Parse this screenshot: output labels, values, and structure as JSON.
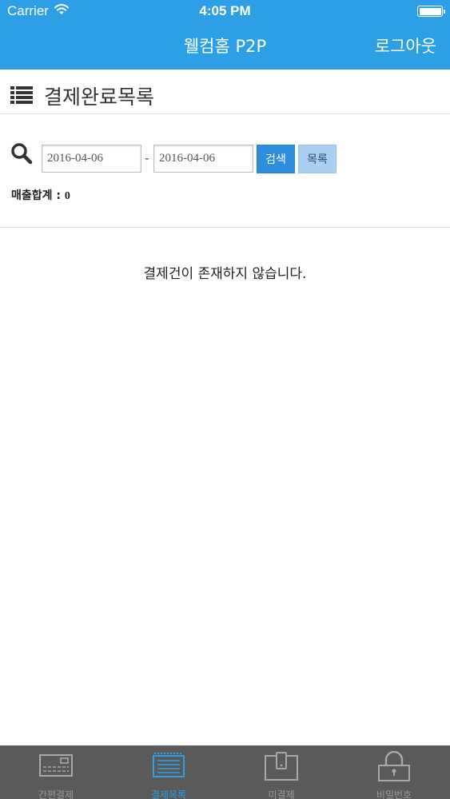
{
  "status_bar": {
    "carrier": "Carrier",
    "time": "4:05 PM"
  },
  "nav": {
    "title": "웰컴홈 P2P",
    "logout_label": "로그아웃"
  },
  "section": {
    "title": "결제완료목록",
    "icon": "list-icon"
  },
  "search": {
    "icon": "search-icon",
    "date_from": "2016-04-06",
    "separator": "-",
    "date_to": "2016-04-06",
    "search_button": "검색",
    "list_button": "목록"
  },
  "summary": {
    "label": "매출합계 : ",
    "value": "0"
  },
  "empty_message": "결제건이 존재하지 않습니다.",
  "tabs": [
    {
      "label": "간편결제",
      "icon": "card-terminal-icon",
      "active": false
    },
    {
      "label": "결제목록",
      "icon": "receipt-list-icon",
      "active": true
    },
    {
      "label": "미결제",
      "icon": "tablet-icon",
      "active": false
    },
    {
      "label": "비밀번호",
      "icon": "lock-icon",
      "active": false
    }
  ],
  "colors": {
    "brand": "#2d9fe6",
    "button_primary": "#2d8ee0",
    "button_secondary": "#a9d0f2",
    "tabbar": "#5a5a5a"
  }
}
